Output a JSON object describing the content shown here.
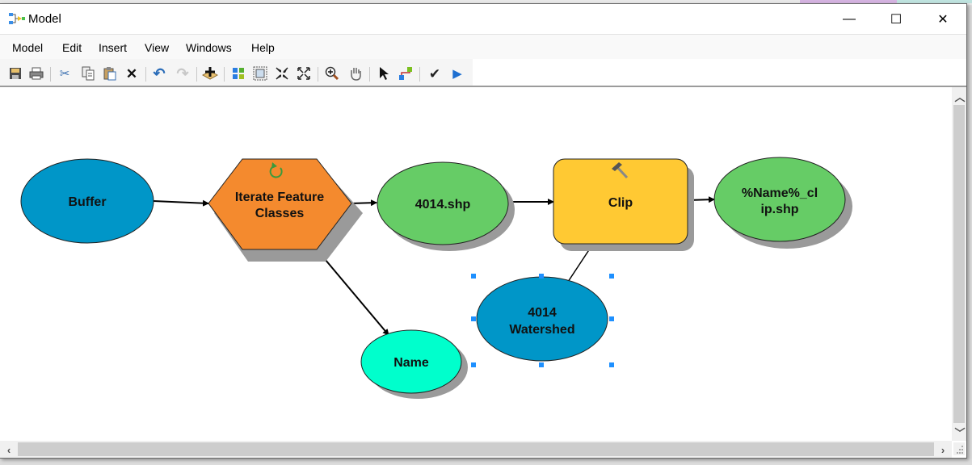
{
  "window": {
    "title": "Model",
    "controls": {
      "minimize": "—",
      "maximize": "☐",
      "close": "✕"
    }
  },
  "menu": [
    "Model",
    "Edit",
    "Insert",
    "View",
    "Windows",
    "Help"
  ],
  "toolbar": [
    {
      "name": "save-icon",
      "glyph": "💾"
    },
    {
      "name": "print-icon",
      "glyph": "🖶"
    },
    {
      "name": "cut-icon",
      "glyph": "✂"
    },
    {
      "name": "copy-icon",
      "glyph": "⎘"
    },
    {
      "name": "paste-icon",
      "glyph": "📋"
    },
    {
      "name": "delete-icon",
      "glyph": "✕"
    },
    {
      "name": "undo-icon",
      "glyph": "↶"
    },
    {
      "name": "redo-icon",
      "glyph": "↷"
    },
    {
      "name": "add-data-icon",
      "glyph": "✚"
    },
    {
      "name": "auto-layout-icon",
      "glyph": "▦"
    },
    {
      "name": "full-extent-icon",
      "glyph": "⛶"
    },
    {
      "name": "zoom-in-fixed-icon",
      "glyph": "⤡"
    },
    {
      "name": "zoom-out-fixed-icon",
      "glyph": "⤢"
    },
    {
      "name": "zoom-in-icon",
      "glyph": "🔍"
    },
    {
      "name": "pan-icon",
      "glyph": "✋"
    },
    {
      "name": "select-icon",
      "glyph": "➤"
    },
    {
      "name": "connect-icon",
      "glyph": "⌐"
    },
    {
      "name": "validate-icon",
      "glyph": "✔"
    },
    {
      "name": "run-icon",
      "glyph": "▶"
    }
  ],
  "colors": {
    "input_blue": "#0096c8",
    "iterator_orange": "#f48a2e",
    "derived_green": "#66cc66",
    "tool_yellow": "#ffc933",
    "variable_cyan": "#00ffcc",
    "selection_handle": "#1e90ff"
  },
  "model": {
    "nodes": [
      {
        "id": "buffer",
        "label": [
          "Buffer"
        ],
        "kind": "input-data"
      },
      {
        "id": "iterate",
        "label": [
          "Iterate Feature",
          "Classes"
        ],
        "kind": "iterator"
      },
      {
        "id": "shp4014",
        "label": [
          "4014.shp"
        ],
        "kind": "derived-data"
      },
      {
        "id": "clip",
        "label": [
          "Clip"
        ],
        "kind": "tool"
      },
      {
        "id": "output",
        "label": [
          "%Name%_cl",
          "ip.shp"
        ],
        "kind": "derived-data"
      },
      {
        "id": "watershed",
        "label": [
          "4014",
          "Watershed"
        ],
        "kind": "input-data",
        "selected": true
      },
      {
        "id": "name",
        "label": [
          "Name"
        ],
        "kind": "variable"
      }
    ],
    "connections": [
      {
        "from": "buffer",
        "to": "iterate"
      },
      {
        "from": "iterate",
        "to": "shp4014"
      },
      {
        "from": "iterate",
        "to": "name"
      },
      {
        "from": "shp4014",
        "to": "clip"
      },
      {
        "from": "watershed",
        "to": "clip"
      },
      {
        "from": "clip",
        "to": "output"
      }
    ]
  }
}
